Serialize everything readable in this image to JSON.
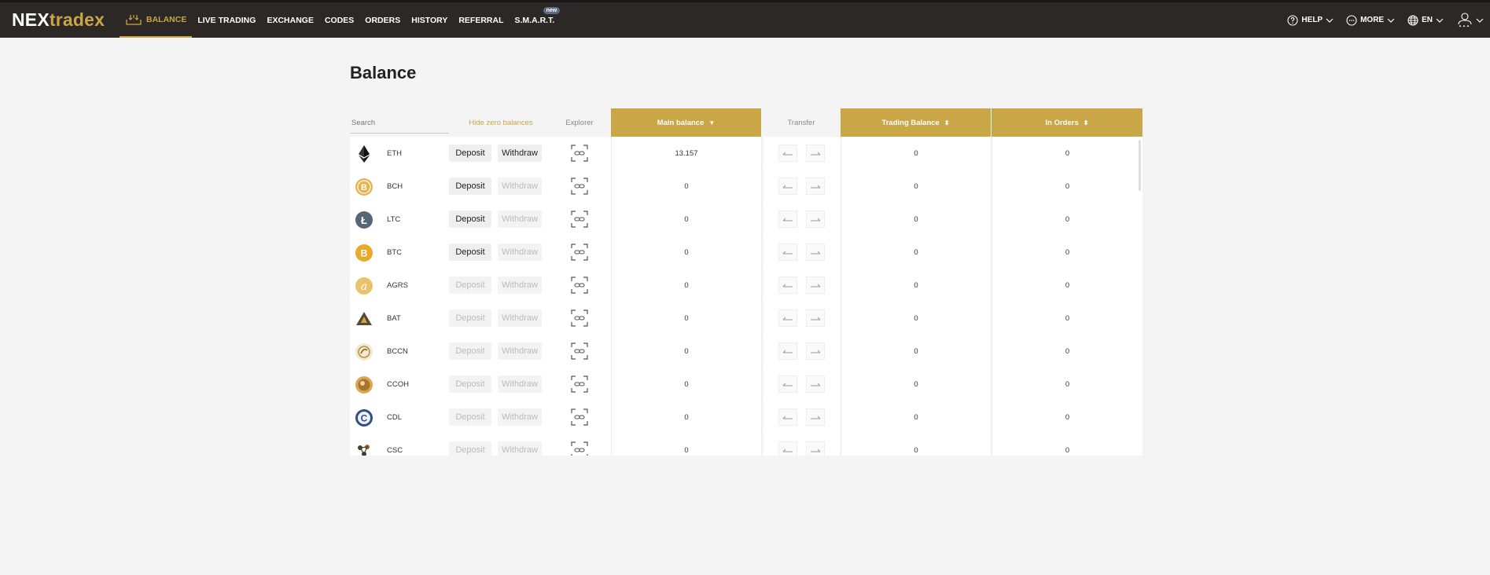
{
  "app": {
    "logo_part1": "NEX",
    "logo_part2": "tradex",
    "accent_color": "#c9a646",
    "topbar_color": "#2b2825"
  },
  "nav": {
    "items": [
      {
        "label": "BALANCE",
        "icon": "balance-icon",
        "active": true
      },
      {
        "label": "LIVE TRADING"
      },
      {
        "label": "EXCHANGE"
      },
      {
        "label": "CODES"
      },
      {
        "label": "ORDERS"
      },
      {
        "label": "HISTORY"
      },
      {
        "label": "REFERRAL"
      },
      {
        "label": "S.M.A.R.T.",
        "badge": "new"
      }
    ],
    "right": {
      "help": "HELP",
      "more": "MORE",
      "lang": "EN"
    }
  },
  "page": {
    "title": "Balance"
  },
  "table": {
    "search_placeholder": "Search",
    "hide_zero": "Hide zero balances",
    "headers": {
      "explorer": "Explorer",
      "main_balance": "Main balance",
      "transfer": "Transfer",
      "trading_balance": "Trading Balance",
      "in_orders": "In Orders"
    },
    "deposit_label": "Deposit",
    "withdraw_label": "Withdraw",
    "rows": [
      {
        "coin": "ETH",
        "icon": "eth-icon",
        "main": "13.157",
        "trading": "0",
        "orders": "0",
        "deposit_enabled": true,
        "withdraw_enabled": true
      },
      {
        "coin": "BCH",
        "icon": "bch-icon",
        "main": "0",
        "trading": "0",
        "orders": "0",
        "deposit_enabled": true,
        "withdraw_enabled": false
      },
      {
        "coin": "LTC",
        "icon": "ltc-icon",
        "main": "0",
        "trading": "0",
        "orders": "0",
        "deposit_enabled": true,
        "withdraw_enabled": false
      },
      {
        "coin": "BTC",
        "icon": "btc-icon",
        "main": "0",
        "trading": "0",
        "orders": "0",
        "deposit_enabled": true,
        "withdraw_enabled": false
      },
      {
        "coin": "AGRS",
        "icon": "agrs-icon",
        "main": "0",
        "trading": "0",
        "orders": "0",
        "deposit_enabled": false,
        "withdraw_enabled": false
      },
      {
        "coin": "BAT",
        "icon": "bat-icon",
        "main": "0",
        "trading": "0",
        "orders": "0",
        "deposit_enabled": false,
        "withdraw_enabled": false
      },
      {
        "coin": "BCCN",
        "icon": "bccn-icon",
        "main": "0",
        "trading": "0",
        "orders": "0",
        "deposit_enabled": false,
        "withdraw_enabled": false
      },
      {
        "coin": "CCOH",
        "icon": "ccoh-icon",
        "main": "0",
        "trading": "0",
        "orders": "0",
        "deposit_enabled": false,
        "withdraw_enabled": false
      },
      {
        "coin": "CDL",
        "icon": "cdl-icon",
        "main": "0",
        "trading": "0",
        "orders": "0",
        "deposit_enabled": false,
        "withdraw_enabled": false
      },
      {
        "coin": "CSC",
        "icon": "csc-icon",
        "main": "0",
        "trading": "0",
        "orders": "0",
        "deposit_enabled": false,
        "withdraw_enabled": false
      }
    ]
  }
}
